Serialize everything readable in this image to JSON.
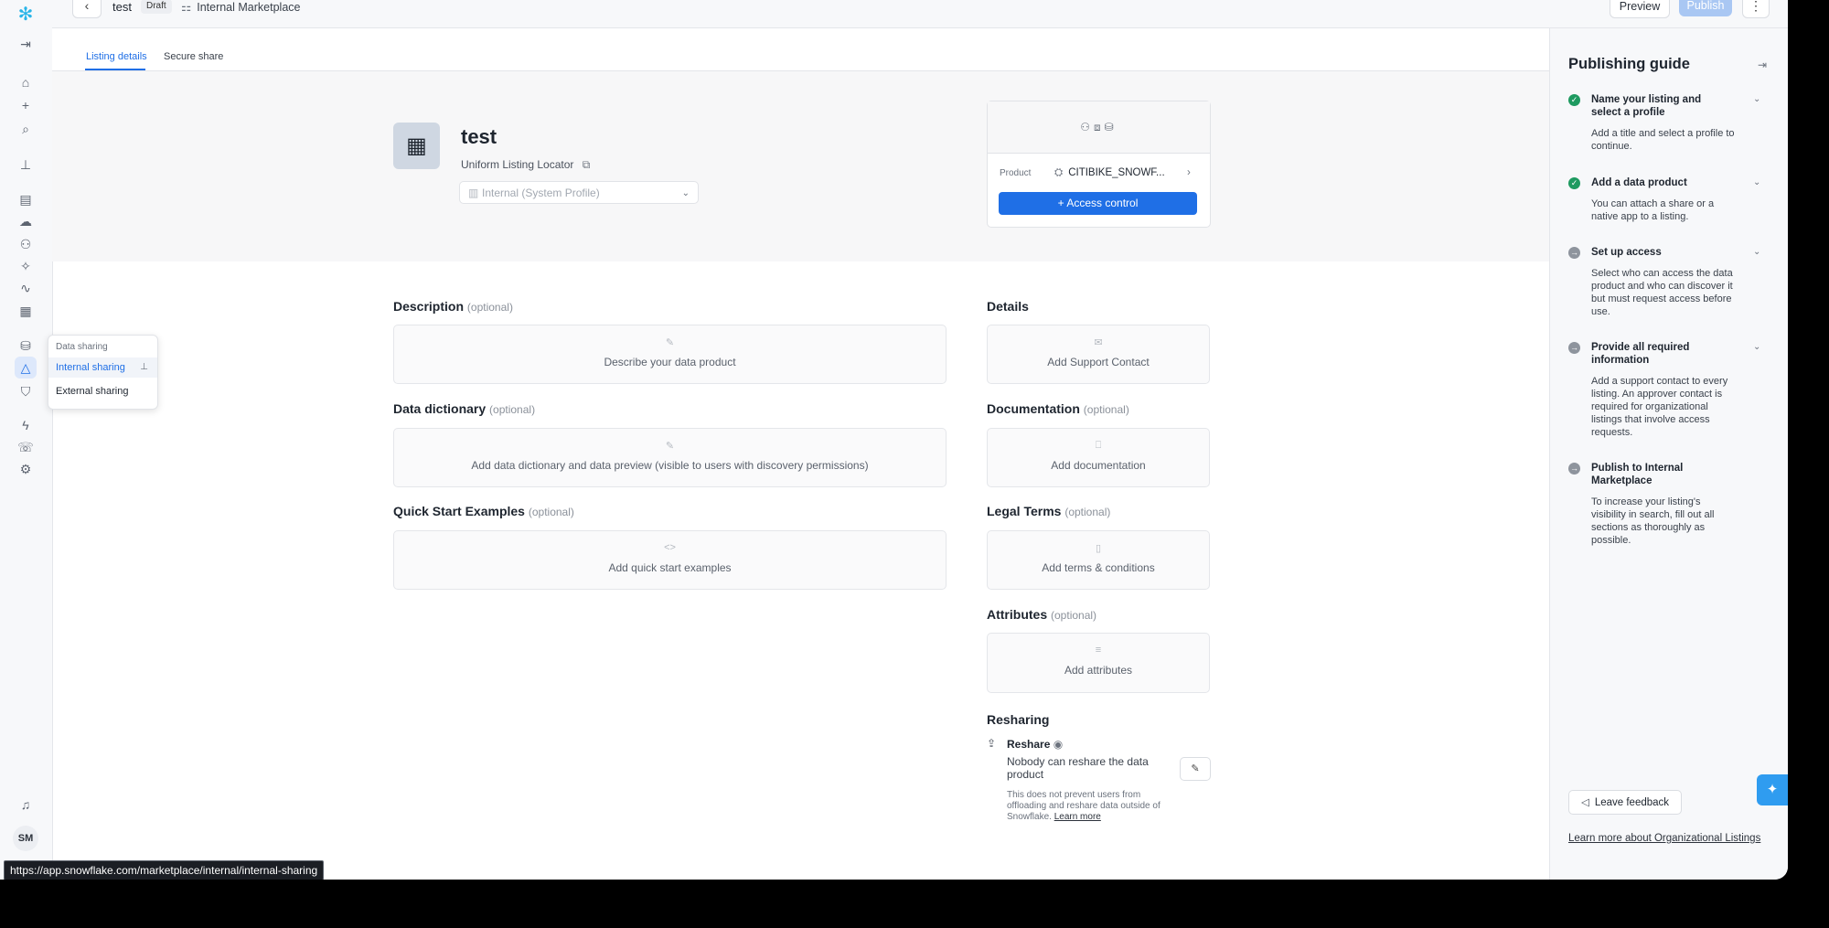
{
  "topbar": {
    "title": "test",
    "status": "Draft",
    "breadcrumb": "Internal Marketplace",
    "preview_label": "Preview",
    "publish_label": "Publish"
  },
  "tabs": [
    {
      "label": "Listing details",
      "active": true
    },
    {
      "label": "Secure share",
      "active": false
    }
  ],
  "listing": {
    "title": "test",
    "ull_label": "Uniform Listing Locator",
    "profile_placeholder": "Internal (System Profile)"
  },
  "product_card": {
    "label": "Product",
    "value": "CITIBIKE_SNOWF...",
    "access_button": "Access control"
  },
  "sections": {
    "description": {
      "title": "Description",
      "optional": "(optional)",
      "action": "Describe your data product"
    },
    "data_dictionary": {
      "title": "Data dictionary",
      "optional": "(optional)",
      "action": "Add data dictionary and data preview (visible to users with discovery permissions)"
    },
    "quick_start": {
      "title": "Quick Start Examples",
      "optional": "(optional)",
      "action": "Add quick start examples"
    },
    "details": {
      "title": "Details",
      "action": "Add Support Contact"
    },
    "documentation": {
      "title": "Documentation",
      "optional": "(optional)",
      "action": "Add documentation"
    },
    "legal_terms": {
      "title": "Legal Terms",
      "optional": "(optional)",
      "action": "Add terms & conditions"
    },
    "attributes": {
      "title": "Attributes",
      "optional": "(optional)",
      "action": "Add attributes"
    },
    "resharing": {
      "title": "Resharing",
      "reshare_label": "Reshare",
      "reshare_text": "Nobody can reshare the data product",
      "note": "This does not prevent users from offloading and reshare data outside of Snowflake.",
      "learn_more": "Learn more"
    }
  },
  "guide": {
    "title": "Publishing guide",
    "steps": [
      {
        "title": "Name your listing and select a profile",
        "desc": "Add a title and select a profile to continue.",
        "done": true
      },
      {
        "title": "Add a data product",
        "desc": "You can attach a share or a native app to a listing.",
        "done": true
      },
      {
        "title": "Set up access",
        "desc": "Select who can access the data product and who can discover it but must request access before use.",
        "done": false
      },
      {
        "title": "Provide all required information",
        "desc": "Add a support contact to every listing. An approver contact is required for organizational listings that involve access requests.",
        "done": false
      },
      {
        "title": "Publish to Internal Marketplace",
        "desc": "To increase your listing's visibility in search, fill out all sections as thoroughly as possible.",
        "done": false
      }
    ],
    "feedback_label": "Leave feedback",
    "learn_link": "Learn more about Organizational Listings"
  },
  "popover": {
    "heading": "Data sharing",
    "items": [
      {
        "label": "Internal sharing",
        "active": true
      },
      {
        "label": "External sharing",
        "active": false
      }
    ]
  },
  "user": {
    "initials": "SM"
  },
  "status_url": "https://app.snowflake.com/marketplace/internal/internal-sharing",
  "colors": {
    "accent": "#1f6fe6",
    "success": "#1e9a60",
    "brand": "#29b5e8"
  }
}
